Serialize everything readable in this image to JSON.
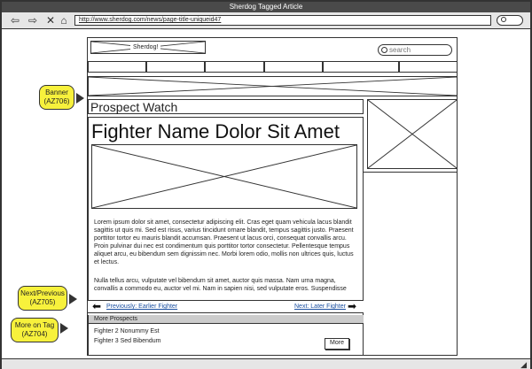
{
  "window": {
    "title": "Sherdog Tagged Article"
  },
  "browser": {
    "url": "http://www.sherdog.com/news/page-title-uniqueid47"
  },
  "header": {
    "logo_text": "Sherdog!",
    "search_placeholder": "search"
  },
  "annotations": {
    "banner": {
      "line1": "Banner",
      "line2": "(AZ706)"
    },
    "next_previous": {
      "line1": "Next/Previous",
      "line2": "(AZ705)"
    },
    "more_on_tag": {
      "line1": "More on Tag",
      "line2": "(AZ704)"
    }
  },
  "section": {
    "title": "Prospect Watch"
  },
  "article": {
    "headline": "Fighter Name Dolor Sit Amet",
    "paragraph1": "Lorem ipsum dolor sit amet, consectetur adipiscing elit. Cras eget quam vehicula lacus blandit sagittis ut quis mi. Sed est risus, varius tincidunt ornare blandit, tempus sagittis justo. Praesent porttitor tortor eu mauris blandit accumsan. Praesent ut lacus orci, consequat convallis arcu. Proin pulvinar dui nec est condimentum quis porttitor tortor consectetur. Pellentesque tempus aliquet arcu, eu bibendum sem dignissim nec. Morbi lorem odio, mollis non ultrices quis, luctus et lectus.",
    "paragraph2": "Nulla tellus arcu, vulputate vel bibendum sit amet, auctor quis massa. Nam urna magna, convallis a commodo eu, auctor vel mi. Nam in sapien nisi, sed vulputate eros. Suspendisse"
  },
  "pagination": {
    "previous_label": "Previously: Earlier Fighter",
    "next_label": "Next: Later Fighter"
  },
  "more_prospects": {
    "header": "More Prospects",
    "items": [
      "Fighter 2 Nonummy Est",
      "Fighter 3 Sed Bibendum"
    ],
    "more_button": "More"
  }
}
